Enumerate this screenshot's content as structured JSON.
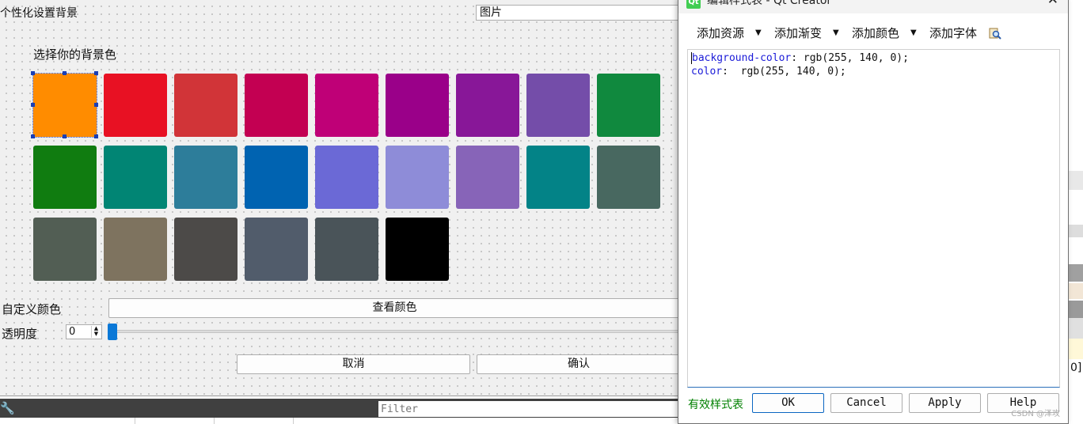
{
  "designer": {
    "title": "个性化设置背景",
    "bg_type_value": "图片",
    "choose_label": "选择你的背景色",
    "swatches": [
      "#ff8c00",
      "#e81123",
      "#d13438",
      "#c30052",
      "#bf0077",
      "#9a0089",
      "#881798",
      "#744da9",
      "#10893e",
      "#107c10",
      "#018574",
      "#2d7d9a",
      "#0063b1",
      "#6b69d6",
      "#8e8cd8",
      "#8764b8",
      "#038387",
      "#486860",
      "#525e54",
      "#7e735f",
      "#4c4a48",
      "#515c6b",
      "#4a5459",
      "#000000"
    ],
    "custom_label": "自定义颜色",
    "view_color_button": "查看颜色",
    "opacity_label": "透明度",
    "opacity_value": "0",
    "cancel_button": "取消",
    "confirm_button": "确认"
  },
  "bottom": {
    "filter_placeholder": "Filter"
  },
  "dialog": {
    "title": "编辑样式表 - Qt Creator",
    "logo": "Qt",
    "toolbar": {
      "add_resource": "添加资源",
      "add_gradient": "添加渐变",
      "add_color": "添加颜色",
      "add_font": "添加字体"
    },
    "code": {
      "line1_prop": "background-color",
      "line1_value": ": rgb(255, 140, 0);",
      "line2_prop": "color",
      "line2_value": ":  rgb(255, 140, 0);"
    },
    "valid_label": "有效样式表",
    "buttons": {
      "ok": "OK",
      "cancel": "Cancel",
      "apply": "Apply",
      "help": "Help"
    },
    "watermark": "CSDN @泽攻"
  },
  "edge": {
    "text": "0]"
  }
}
